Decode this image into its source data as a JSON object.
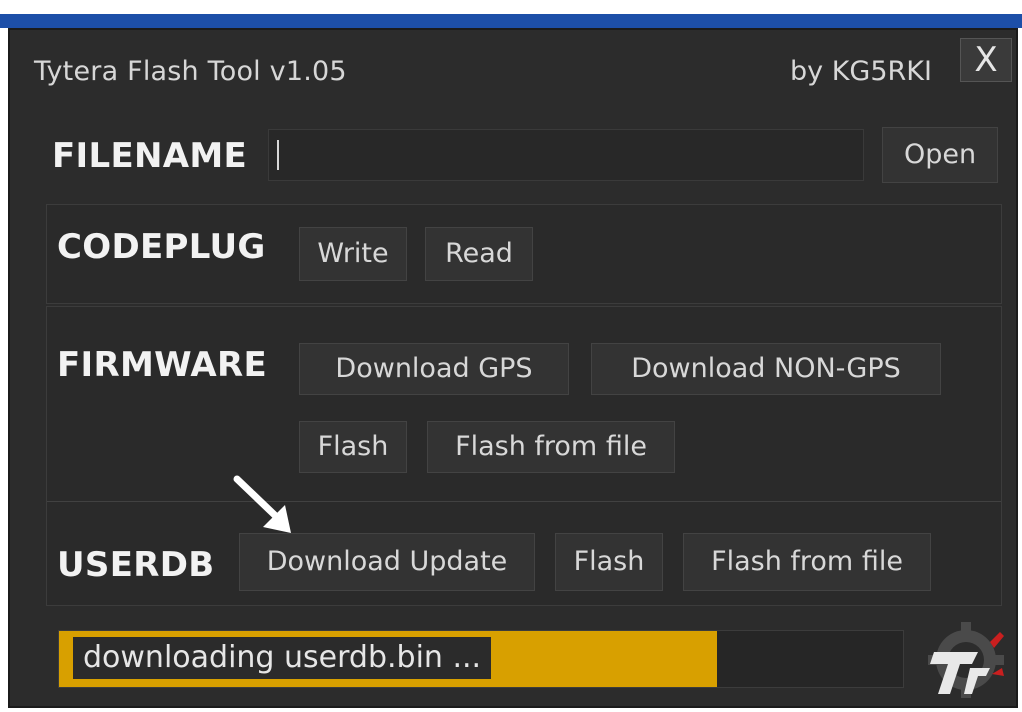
{
  "window": {
    "title": "Tytera Flash Tool  v1.05",
    "author": "by KG5RKI",
    "close_label": "X"
  },
  "filename": {
    "heading": "FILENAME",
    "value": "",
    "open_label": "Open"
  },
  "codeplug": {
    "heading": "CODEPLUG",
    "write_label": "Write",
    "read_label": "Read"
  },
  "firmware": {
    "heading": "FIRMWARE",
    "download_gps_label": "Download GPS",
    "download_non_gps_label": "Download NON-GPS",
    "flash_label": "Flash",
    "flash_from_file_label": "Flash from file"
  },
  "userdb": {
    "heading": "USERDB",
    "download_update_label": "Download Update",
    "flash_label": "Flash",
    "flash_from_file_label": "Flash from file"
  },
  "progress": {
    "text": "downloading userdb.bin ...",
    "fraction": 0.78
  },
  "colors": {
    "title_blue": "#1d4fa8",
    "window_bg": "#2c2c2c",
    "progress_fill": "#d8a000",
    "logo_red": "#c91f1f"
  },
  "icons": {
    "arrow": "pointer-arrow-icon",
    "logo": "app-logo-gear-icon"
  }
}
